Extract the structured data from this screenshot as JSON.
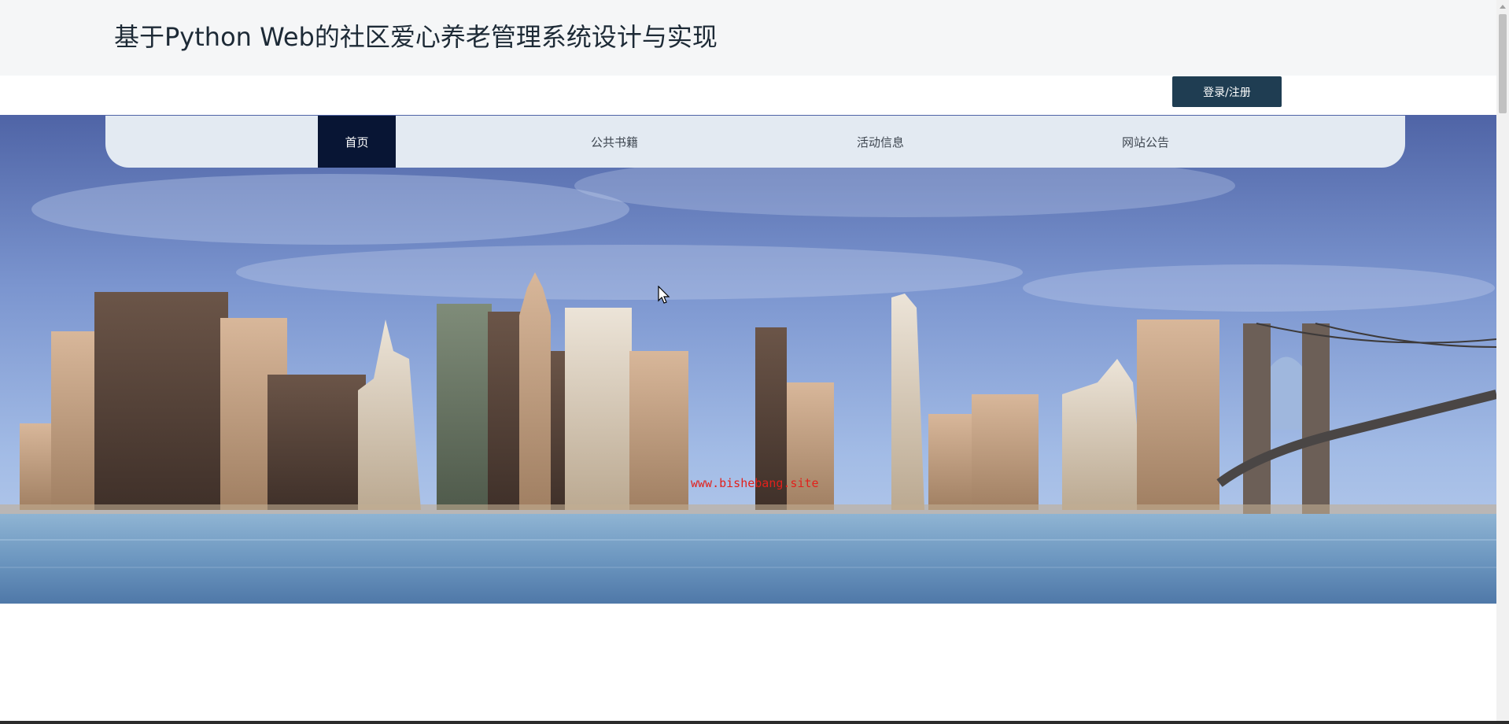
{
  "header": {
    "title": "基于Python Web的社区爱心养老管理系统设计与实现",
    "login_label": "登录/注册"
  },
  "nav": {
    "items": [
      {
        "label": "首页",
        "active": true
      },
      {
        "label": "公共书籍",
        "active": false
      },
      {
        "label": "活动信息",
        "active": false
      },
      {
        "label": "网站公告",
        "active": false
      }
    ]
  },
  "banner": {
    "watermark": "www.bishebang.site",
    "image_subject": "city-skyline-with-bridge-over-river"
  },
  "colors": {
    "header_bg": "#f5f6f7",
    "nav_bg": "#e3eaf2",
    "nav_active_bg": "#081534",
    "login_button_bg": "#1f3d52",
    "indicator": "#226f72",
    "watermark": "#e2211c"
  }
}
